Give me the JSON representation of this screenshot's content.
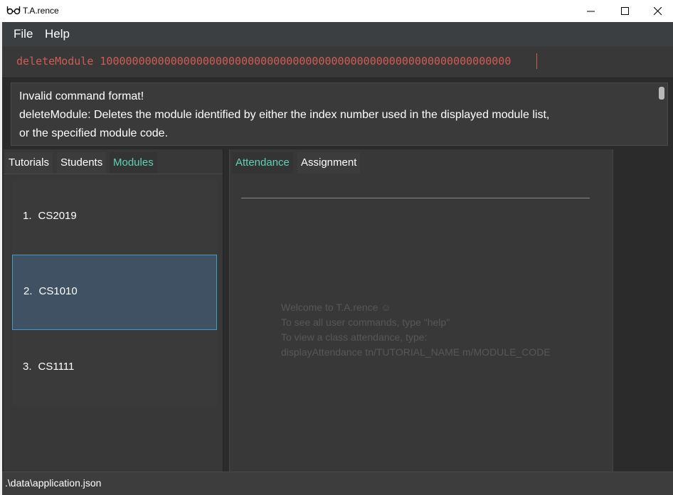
{
  "window": {
    "title": "T.A.rence",
    "icon": "glasses-icon"
  },
  "menu": {
    "file": "File",
    "help": "Help"
  },
  "command": {
    "value": "deleteModule 1000000000000000000000000000000000000000000000000000000000000000"
  },
  "result": {
    "lines": [
      "Invalid command format!",
      "deleteModule: Deletes the module identified by either the index number used in the displayed module list,",
      "or the specified module code."
    ]
  },
  "left_tabs": {
    "tutorials": "Tutorials",
    "students": "Students",
    "modules": "Modules",
    "active": "Modules"
  },
  "modules": [
    {
      "index": "1.",
      "code": "CS2019"
    },
    {
      "index": "2.",
      "code": "CS1010"
    },
    {
      "index": "3.",
      "code": "CS1111"
    }
  ],
  "right_tabs": {
    "attendance": "Attendance",
    "assignment": "Assignment",
    "active": "Attendance"
  },
  "welcome": {
    "lines": [
      "Welcome to T.A.rence ☺",
      "To see all user commands, type \"help\"",
      "To view a class attendance, type:",
      "displayAttendance tn/TUTORIAL_NAME m/MODULE_CODE"
    ]
  },
  "status": {
    "path": ".\\data\\application.json"
  },
  "colors": {
    "accent": "#5fd1b6",
    "command_text": "#d05c53",
    "selected_bg": "#3f5163",
    "selected_border": "#3e9dc4"
  }
}
